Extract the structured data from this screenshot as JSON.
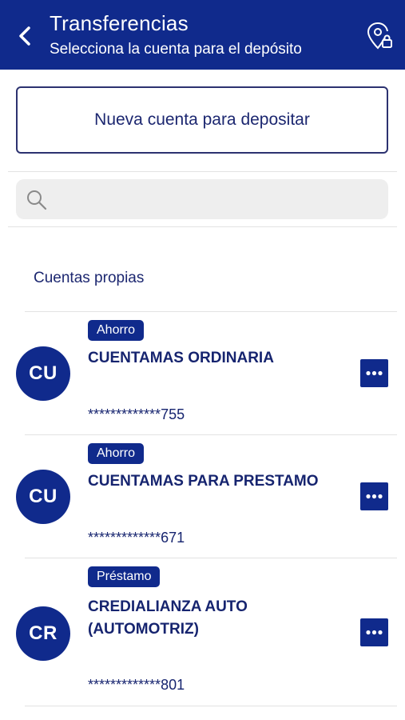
{
  "header": {
    "title": "Transferencias",
    "subtitle": "Selecciona la cuenta para el depósito",
    "back_icon": "chevron-left-icon",
    "location_icon": "location-lock-icon"
  },
  "new_account_button": "Nueva cuenta para depositar",
  "search": {
    "value": "",
    "placeholder": ""
  },
  "section_title": "Cuentas propias",
  "accounts": [
    {
      "badge": "Ahorro",
      "initials": "CU",
      "name": "CUENTAMAS ORDINARIA",
      "number": "*************755"
    },
    {
      "badge": "Ahorro",
      "initials": "CU",
      "name": "CUENTAMAS PARA PRESTAMO",
      "number": "*************671"
    },
    {
      "badge": "Préstamo",
      "initials": "CR",
      "name": "CREDIALIANZA AUTO (AUTOMOTRIZ)",
      "number": "*************801"
    }
  ],
  "colors": {
    "brand": "#102a8c",
    "text": "#16246f",
    "divider": "#e3e3e3",
    "search_bg": "#eeeeee"
  }
}
